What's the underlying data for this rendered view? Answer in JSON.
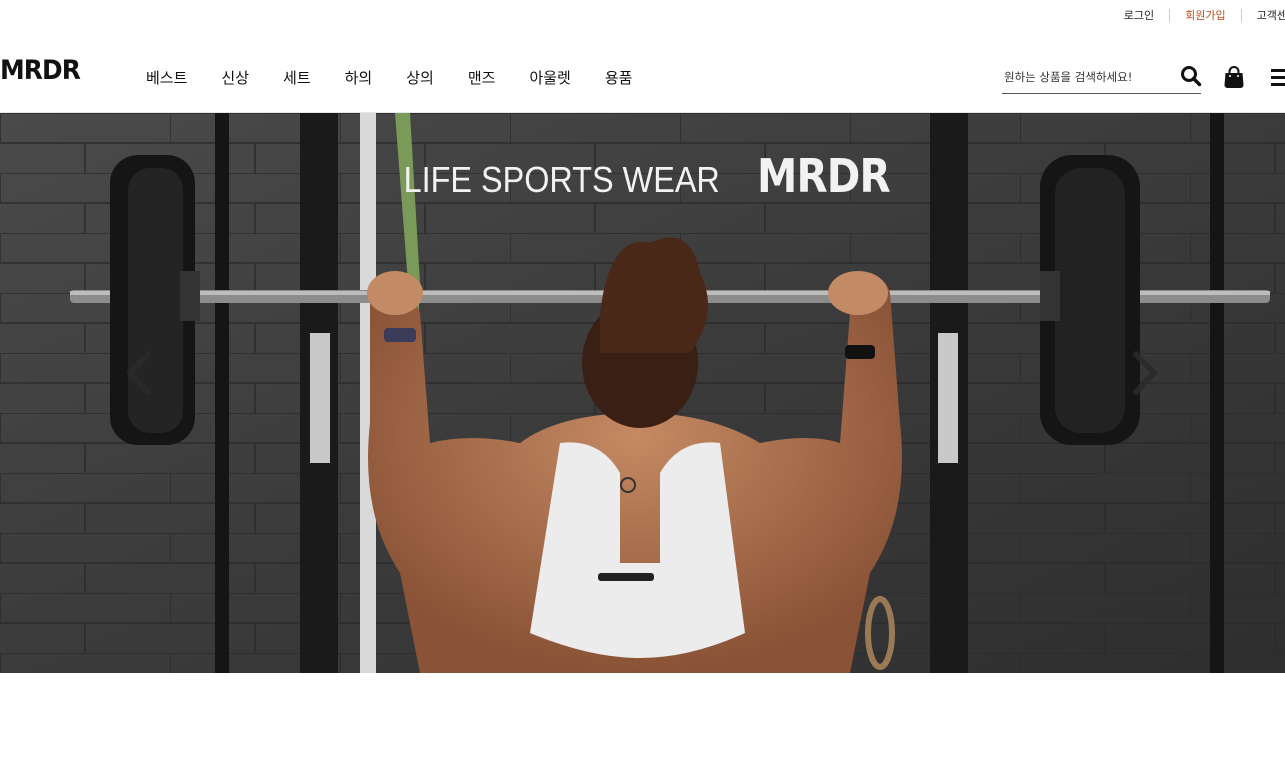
{
  "util_nav": {
    "login": "로그인",
    "signup": "회원가입",
    "support": "고객센"
  },
  "header": {
    "logo": "MRDR",
    "nav": [
      {
        "label": "베스트"
      },
      {
        "label": "신상"
      },
      {
        "label": "세트"
      },
      {
        "label": "하의"
      },
      {
        "label": "상의"
      },
      {
        "label": "맨즈"
      },
      {
        "label": "아울렛"
      },
      {
        "label": "용품"
      }
    ],
    "search_placeholder": "원하는 상품을 검색하세요!",
    "icons": {
      "search": "search-icon",
      "bag": "shopping-bag-icon",
      "menu": "hamburger-menu-icon"
    }
  },
  "hero": {
    "headline_light": "LIFE SPORTS WEAR",
    "headline_bold": "MRDR",
    "prev_icon": "chevron-left-icon",
    "next_icon": "chevron-right-icon"
  },
  "colors": {
    "accent": "#c0501c",
    "text": "#111111",
    "hero_wall": "#3a3a3a"
  }
}
